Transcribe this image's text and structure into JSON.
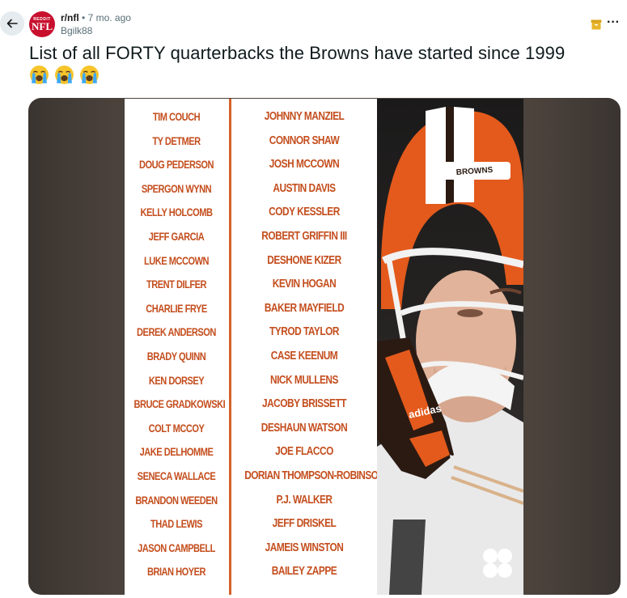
{
  "post": {
    "subreddit": "r/nfl",
    "separator": "•",
    "age": "7 mo. ago",
    "author": "Bgilk88",
    "avatar": {
      "top_text": "REDDIT",
      "main_text": "NFL"
    },
    "title": "List of all FORTY quarterbacks the Browns have started since 1999",
    "emojis": [
      "loudly-crying-face",
      "loudly-crying-face",
      "loudly-crying-face"
    ]
  },
  "image": {
    "left_column": [
      "TIM COUCH",
      "TY DETMER",
      "DOUG PEDERSON",
      "SPERGON WYNN",
      "KELLY HOLCOMB",
      "JEFF GARCIA",
      "LUKE MCCOWN",
      "TRENT DILFER",
      "CHARLIE FRYE",
      "DEREK ANDERSON",
      "BRADY QUINN",
      "KEN DORSEY",
      "BRUCE GRADKOWSKI",
      "COLT MCCOY",
      "JAKE DELHOMME",
      "SENECA WALLACE",
      "BRANDON WEEDEN",
      "THAD LEWIS",
      "JASON CAMPBELL",
      "BRIAN HOYER"
    ],
    "right_column": [
      "JOHNNY MANZIEL",
      "CONNOR SHAW",
      "JOSH MCCOWN",
      "AUSTIN DAVIS",
      "CODY KESSLER",
      "ROBERT GRIFFIN III",
      "DESHONE KIZER",
      "KEVIN HOGAN",
      "BAKER MAYFIELD",
      "TYROD TAYLOR",
      "CASE KEENUM",
      "NICK MULLENS",
      "JACOBY BRISSETT",
      "DESHAUN WATSON",
      "JOE FLACCO",
      "DORIAN THOMPSON-ROBINSON",
      "P.J. WALKER",
      "JEFF DRISKEL",
      "JAMEIS WINSTON",
      "BAILEY ZAPPE"
    ],
    "helmet_text": "BROWNS",
    "glove_text": "adidas",
    "colors": {
      "accent": "#c44e1e",
      "helmet_orange": "#e35a1c"
    }
  }
}
